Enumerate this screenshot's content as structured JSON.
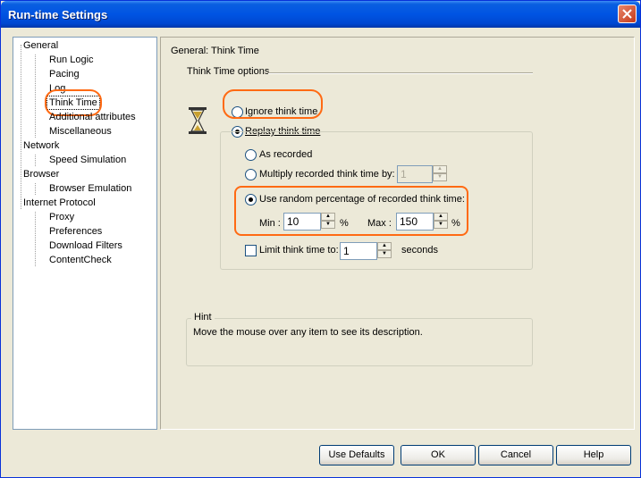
{
  "window": {
    "title": "Run-time Settings"
  },
  "tree": {
    "items": [
      {
        "label": "General",
        "level": 0
      },
      {
        "label": "Run Logic",
        "level": 1
      },
      {
        "label": "Pacing",
        "level": 1
      },
      {
        "label": "Log",
        "level": 1
      },
      {
        "label": "Think Time",
        "level": 1,
        "selected": true
      },
      {
        "label": "Additional attributes",
        "level": 1
      },
      {
        "label": "Miscellaneous",
        "level": 1
      },
      {
        "label": "Network",
        "level": 0
      },
      {
        "label": "Speed Simulation",
        "level": 1
      },
      {
        "label": "Browser",
        "level": 0
      },
      {
        "label": "Browser Emulation",
        "level": 1
      },
      {
        "label": "Internet Protocol",
        "level": 0
      },
      {
        "label": "Proxy",
        "level": 1
      },
      {
        "label": "Preferences",
        "level": 1
      },
      {
        "label": "Download Filters",
        "level": 1
      },
      {
        "label": "ContentCheck",
        "level": 1
      }
    ]
  },
  "pane": {
    "title": "General: Think Time",
    "section_title": "Think Time options",
    "ignore_label": "Ignore think time",
    "replay_label": "Replay think time",
    "as_recorded_label": "As recorded",
    "multiply_label": "Multiply recorded think time by:",
    "multiply_value": "1",
    "random_label": "Use random percentage of recorded think time:",
    "min_label": "Min :",
    "min_value": "10",
    "max_label": "Max :",
    "max_value": "150",
    "percent": "%",
    "limit_label": "Limit think time to:",
    "limit_value": "1",
    "seconds_label": "seconds",
    "hint_title": "Hint",
    "hint_text": "Move the mouse over any item to see its description."
  },
  "buttons": {
    "use_defaults": "Use Defaults",
    "ok": "OK",
    "cancel": "Cancel",
    "help": "Help"
  },
  "colors": {
    "highlight": "#ff6a13",
    "titlebar": "#0054e3",
    "face": "#ece9d8"
  }
}
